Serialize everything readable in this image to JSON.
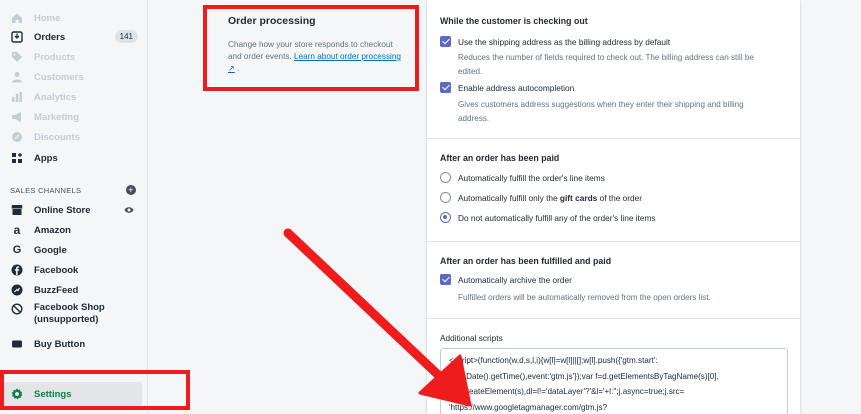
{
  "sidebar": {
    "items": [
      {
        "label": "Home",
        "icon": "home-icon",
        "state": "faded"
      },
      {
        "label": "Orders",
        "icon": "orders-icon",
        "state": "active",
        "badge": "141"
      },
      {
        "label": "Products",
        "icon": "tag-icon",
        "state": "faded"
      },
      {
        "label": "Customers",
        "icon": "person-icon",
        "state": "faded"
      },
      {
        "label": "Analytics",
        "icon": "bar-chart-icon",
        "state": "faded"
      },
      {
        "label": "Marketing",
        "icon": "megaphone-icon",
        "state": "faded"
      },
      {
        "label": "Discounts",
        "icon": "discount-icon",
        "state": "faded"
      },
      {
        "label": "Apps",
        "icon": "apps-icon",
        "state": "active"
      }
    ],
    "channels_heading": "SALES CHANNELS",
    "channels": [
      {
        "label": "Online Store",
        "icon": "store-icon"
      },
      {
        "label": "Amazon",
        "icon": "amazon-icon"
      },
      {
        "label": "Google",
        "icon": "google-icon"
      },
      {
        "label": "Facebook",
        "icon": "facebook-icon"
      },
      {
        "label": "BuzzFeed",
        "icon": "buzzfeed-icon"
      },
      {
        "label": "Facebook Shop",
        "label2": "(unsupported)",
        "icon": "no-icon"
      },
      {
        "label": "Buy Button",
        "icon": "buy-button-icon"
      }
    ],
    "settings_label": "Settings"
  },
  "section": {
    "title": "Order processing",
    "description": "Change how your store responds to checkout and order events.",
    "link": "Learn about order processing"
  },
  "checkout": {
    "title": "While the customer is checking out",
    "option1": "Use the shipping address as the billing address by default",
    "option1_help_a": "Reduces the number of fields required to check out. The billing address can still be",
    "option1_help_b": "edited.",
    "option2": "Enable address autocompletion",
    "option2_help_a": "Gives customers address suggestions when they enter their shipping and billing",
    "option2_help_b": "address."
  },
  "paid": {
    "title": "After an order has been paid",
    "radio1": "Automatically fulfill the order's line items",
    "radio2_pre": "Automatically fulfill only the ",
    "radio2_bold": "gift cards",
    "radio2_post": " of the order",
    "radio3": "Do not automatically fulfill any of the order's line items"
  },
  "fulfilled": {
    "title": "After an order has been fulfilled and paid",
    "option": "Automatically archive the order",
    "help": "Fulfilled orders will be automatically removed from the open orders list."
  },
  "scripts": {
    "label": "Additional scripts",
    "code": "<script>(function(w,d,s,l,i){w[l]=w[l]||[];w[l].push({'gtm.start':\nnew Date().getTime(),event:'gtm.js'});var f=d.getElementsByTagName(s)[0],\nj=d.createElement(s),dl=l!='dataLayer'?'&l='+l:'';j.async=true;j.src=\n'https://www.googletagmanager.com/gtm.js?"
  },
  "colors": {
    "highlight": "#ee1c1c",
    "accent": "#5c6ac4",
    "link": "#006fbb"
  }
}
